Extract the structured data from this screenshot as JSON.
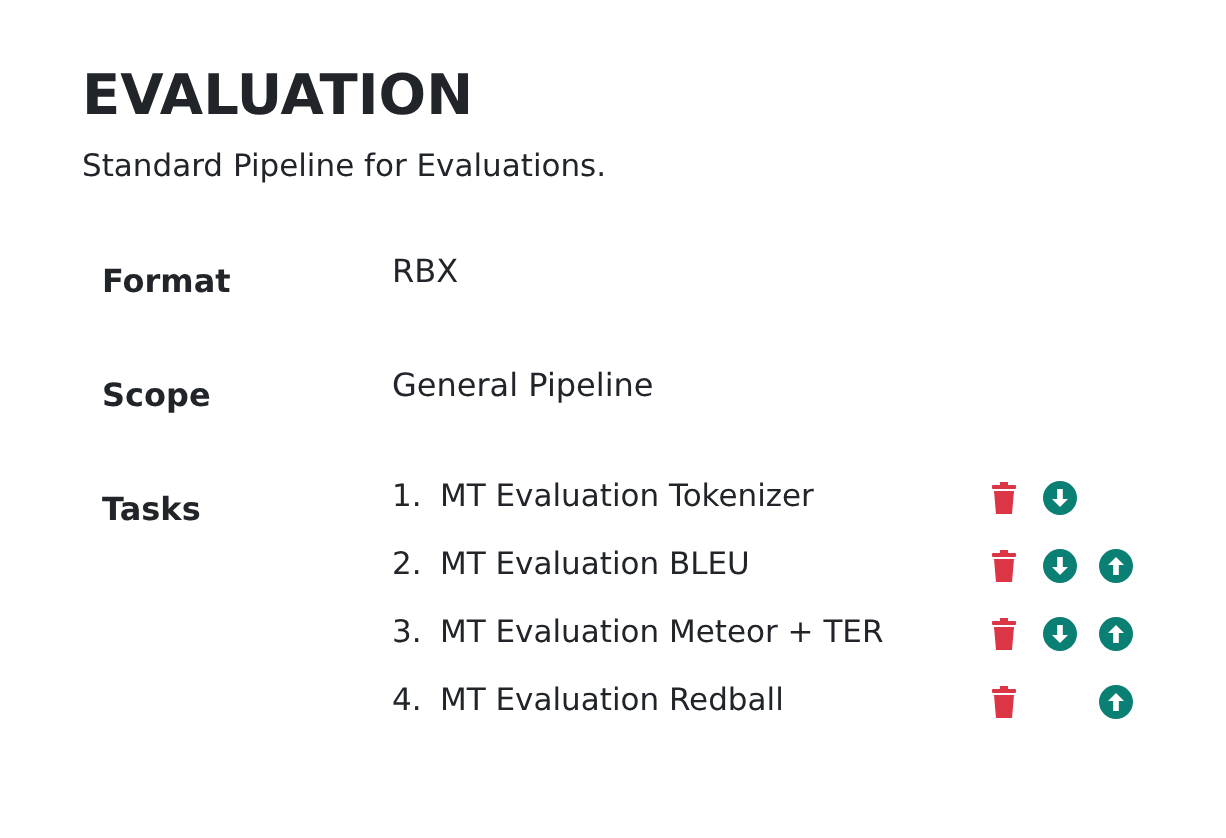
{
  "title": "EVALUATION",
  "description": "Standard Pipeline for Evaluations.",
  "fields": [
    {
      "label": "Format",
      "value": "RBX"
    },
    {
      "label": "Scope",
      "value": "General Pipeline"
    }
  ],
  "tasks_label": "Tasks",
  "tasks": [
    {
      "number": "1.",
      "name": "MT Evaluation Tokenizer",
      "can_move_down": true,
      "can_move_up": false
    },
    {
      "number": "2.",
      "name": "MT Evaluation BLEU",
      "can_move_down": true,
      "can_move_up": true
    },
    {
      "number": "3.",
      "name": "MT Evaluation Meteor + TER",
      "can_move_down": true,
      "can_move_up": true
    },
    {
      "number": "4.",
      "name": "MT Evaluation Redball",
      "can_move_down": false,
      "can_move_up": true
    }
  ]
}
